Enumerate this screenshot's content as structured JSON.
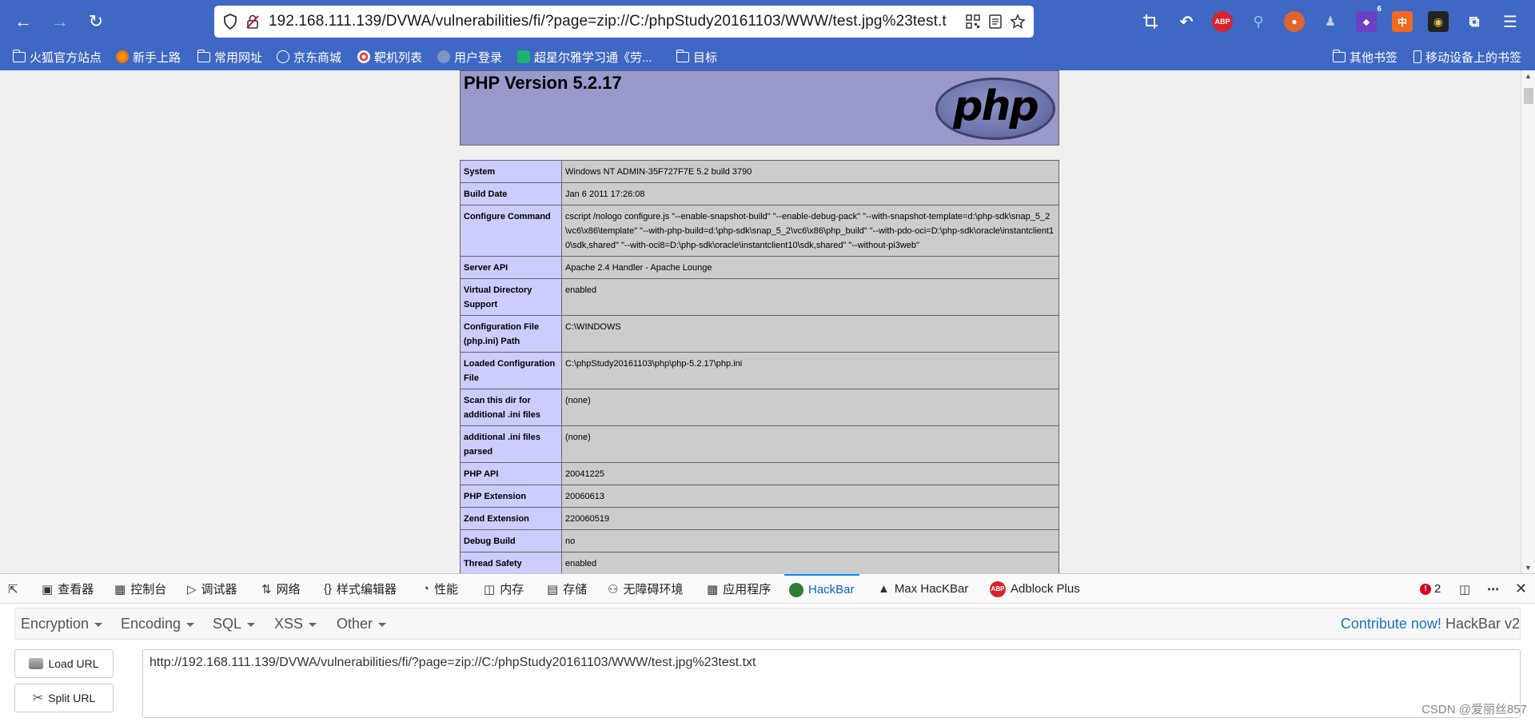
{
  "toolbar": {
    "url": "192.168.111.139/DVWA/vulnerabilities/fi/?page=zip://C:/phpStudy20161103/WWW/test.jpg%23test.t",
    "abp_label": "ABP",
    "badge_count": "6"
  },
  "bookmarks": [
    {
      "label": "火狐官方站点"
    },
    {
      "label": "新手上路"
    },
    {
      "label": "常用网址"
    },
    {
      "label": "京东商城"
    },
    {
      "label": "靶机列表"
    },
    {
      "label": "用户登录"
    },
    {
      "label": "超星尔雅学习通《劳..."
    },
    {
      "label": "目标"
    }
  ],
  "bookmarks_right": [
    {
      "label": "其他书签"
    },
    {
      "label": "移动设备上的书签"
    }
  ],
  "phpinfo": {
    "title": "PHP Version 5.2.17",
    "logo_text": "php",
    "rows": [
      {
        "key": "System",
        "value": "Windows NT ADMIN-35F727F7E 5.2 build 3790"
      },
      {
        "key": "Build Date",
        "value": "Jan 6 2011 17:26:08"
      },
      {
        "key": "Configure Command",
        "value": "cscript /nologo configure.js \"--enable-snapshot-build\" \"--enable-debug-pack\" \"--with-snapshot-template=d:\\php-sdk\\snap_5_2\\vc6\\x86\\template\" \"--with-php-build=d:\\php-sdk\\snap_5_2\\vc6\\x86\\php_build\" \"--with-pdo-oci=D:\\php-sdk\\oracle\\instantclient10\\sdk,shared\" \"--with-oci8=D:\\php-sdk\\oracle\\instantclient10\\sdk,shared\" \"--without-pi3web\""
      },
      {
        "key": "Server API",
        "value": "Apache 2.4 Handler - Apache Lounge"
      },
      {
        "key": "Virtual Directory Support",
        "value": "enabled"
      },
      {
        "key": "Configuration File (php.ini) Path",
        "value": "C:\\WINDOWS"
      },
      {
        "key": "Loaded Configuration File",
        "value": "C:\\phpStudy20161103\\php\\php-5.2.17\\php.ini"
      },
      {
        "key": "Scan this dir for additional .ini files",
        "value": "(none)"
      },
      {
        "key": "additional .ini files parsed",
        "value": "(none)"
      },
      {
        "key": "PHP API",
        "value": "20041225"
      },
      {
        "key": "PHP Extension",
        "value": "20060613"
      },
      {
        "key": "Zend Extension",
        "value": "220060519"
      },
      {
        "key": "Debug Build",
        "value": "no"
      },
      {
        "key": "Thread Safety",
        "value": "enabled"
      }
    ]
  },
  "devtools": {
    "tabs": [
      {
        "label": "查看器",
        "icon": "inspector-icon"
      },
      {
        "label": "控制台",
        "icon": "console-icon"
      },
      {
        "label": "调试器",
        "icon": "debugger-icon"
      },
      {
        "label": "网络",
        "icon": "network-icon"
      },
      {
        "label": "样式编辑器",
        "icon": "style-editor-icon"
      },
      {
        "label": "性能",
        "icon": "performance-icon"
      },
      {
        "label": "内存",
        "icon": "memory-icon"
      },
      {
        "label": "存储",
        "icon": "storage-icon"
      },
      {
        "label": "无障碍环境",
        "icon": "accessibility-icon"
      },
      {
        "label": "应用程序",
        "icon": "application-icon"
      },
      {
        "label": "HackBar",
        "icon": "hackbar-icon"
      },
      {
        "label": "Max HacKBar",
        "icon": "max-hackbar-icon"
      },
      {
        "label": "Adblock Plus",
        "icon": "adblock-icon"
      }
    ],
    "error_count": "2"
  },
  "hackbar": {
    "menu": [
      "Encryption",
      "Encoding",
      "SQL",
      "XSS",
      "Other"
    ],
    "contribute": "Contribute now!",
    "version": "HackBar v2",
    "load_url": "Load URL",
    "split_url": "Split URL",
    "url_value": "http://192.168.111.139/DVWA/vulnerabilities/fi/?page=zip://C:/phpStudy20161103/WWW/test.jpg%23test.txt"
  },
  "watermark": "CSDN @爱丽丝857",
  "colors": {
    "toolbar": "#3f68c4",
    "php_header": "#9999cc",
    "php_key": "#ccccff",
    "php_value": "#cccccc",
    "accent": "#0a84ff"
  }
}
